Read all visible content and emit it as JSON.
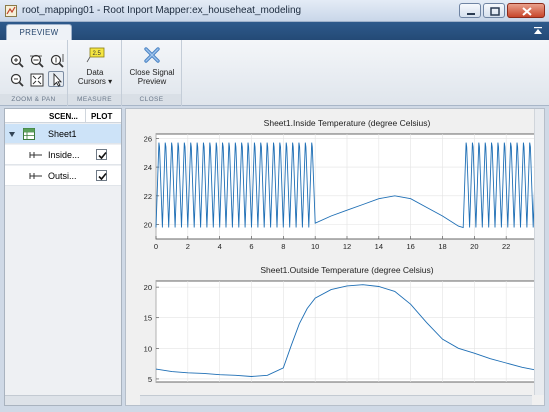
{
  "window": {
    "title": "root_mapping01 - Root Inport Mapper:ex_househeat_modeling",
    "colors": {
      "titlebar": "#c9d7e9",
      "tabstrip": "#244a76",
      "close": "#c7452b"
    }
  },
  "toolstrip": {
    "tab_label": "PREVIEW",
    "sections": {
      "zoom_pan_label": "ZOOM & PAN",
      "measure_label": "MEASURE",
      "close_label": "CLOSE"
    },
    "data_cursors_line1": "Data",
    "data_cursors_line2": "Cursors ▾",
    "data_cursors_badge": "2.5",
    "close_preview_line1": "Close Signal",
    "close_preview_line2": "Preview",
    "icons": [
      "zoom-in-icon",
      "zoom-in-x-icon",
      "zoom-in-y-icon",
      "zoom-out-icon",
      "fit-to-view-icon",
      "pointer-icon",
      "data-cursor-icon",
      "close-x-icon"
    ]
  },
  "signal_table": {
    "col_scenario": "SCEN...",
    "col_plot": "PLOT",
    "rows": [
      {
        "label": "Sheet1",
        "checked": null,
        "selected": true
      },
      {
        "label": "Inside...",
        "checked": true,
        "selected": false
      },
      {
        "label": "Outsi...",
        "checked": true,
        "selected": false
      }
    ]
  },
  "chart_data": [
    {
      "type": "line",
      "title": "Sheet1.Inside Temperature (degree Celsius)",
      "xlim": [
        0,
        24
      ],
      "ylim": [
        19,
        26.3
      ],
      "xticks": [
        0,
        2,
        4,
        6,
        8,
        10,
        12,
        14,
        16,
        18,
        20,
        22
      ],
      "yticks": [
        20,
        22,
        24,
        26
      ],
      "grid": true,
      "series": [
        {
          "color": "#1f6fb5",
          "segments": [
            {
              "kind": "oscillation",
              "x_start": 0,
              "x_end": 10,
              "low": 19.8,
              "high": 25.7,
              "period": 0.4
            },
            {
              "kind": "smooth",
              "x": [
                10,
                11,
                12,
                13,
                14,
                15,
                16,
                17,
                18,
                19,
                19.3
              ],
              "y": [
                20.1,
                20.6,
                21.0,
                21.4,
                21.8,
                22.0,
                21.8,
                21.2,
                20.6,
                19.9,
                19.8
              ]
            },
            {
              "kind": "oscillation",
              "x_start": 19.3,
              "x_end": 24,
              "low": 19.8,
              "high": 25.7,
              "period": 0.4
            }
          ]
        }
      ]
    },
    {
      "type": "line",
      "title": "Sheet1.Outside Temperature (degree Celsius)",
      "xlim": [
        0,
        24
      ],
      "ylim": [
        4.5,
        21
      ],
      "yticks": [
        5,
        10,
        15,
        20
      ],
      "grid": true,
      "series": [
        {
          "color": "#1f6fb5",
          "x": [
            0,
            1,
            2,
            3,
            4,
            5,
            6,
            7,
            8,
            8.5,
            9,
            9.5,
            10,
            11,
            12,
            13,
            14,
            15,
            16,
            17,
            18,
            19,
            20,
            21,
            22,
            23,
            24
          ],
          "y": [
            6.6,
            6.2,
            6.0,
            5.9,
            5.7,
            5.6,
            5.4,
            5.6,
            6.8,
            10.5,
            14.0,
            16.5,
            18.2,
            19.6,
            20.2,
            20.4,
            20.1,
            19.3,
            17.2,
            14.2,
            11.5,
            10.0,
            9.2,
            8.3,
            7.6,
            6.9,
            6.4
          ]
        }
      ]
    }
  ]
}
